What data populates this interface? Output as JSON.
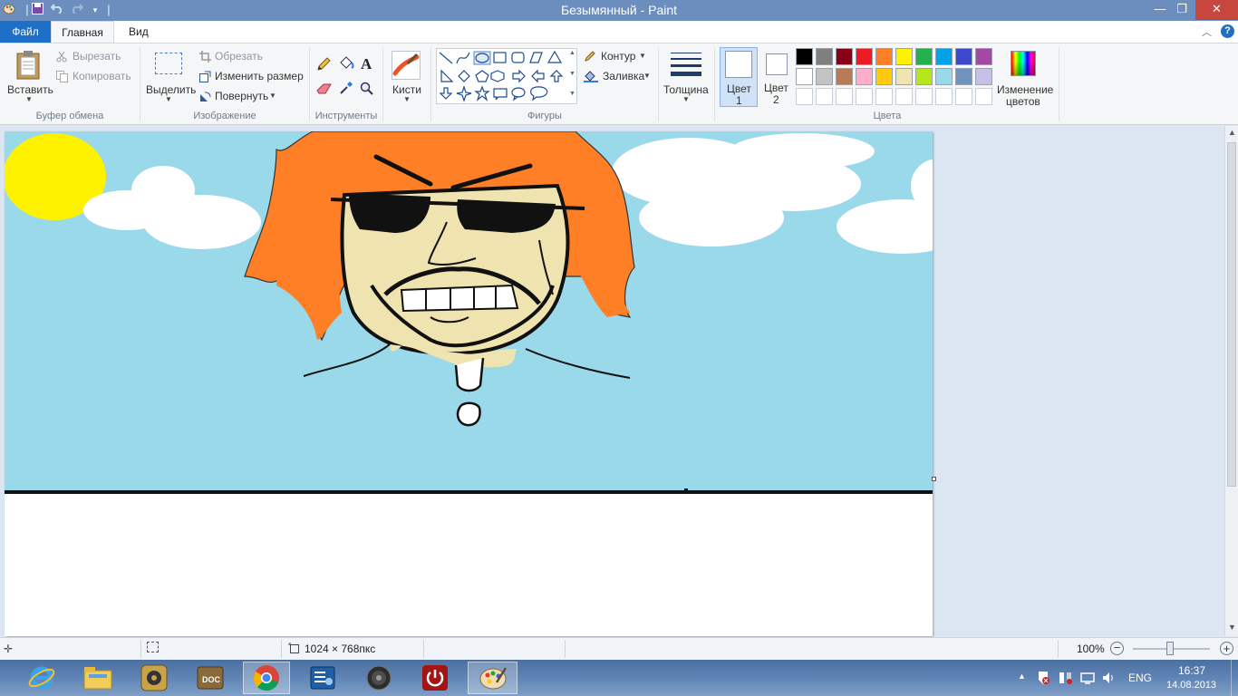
{
  "window": {
    "title": "Безымянный - Paint",
    "minimize_icon": "minimize-icon",
    "restore_icon": "restore-icon",
    "close_icon": "close-icon"
  },
  "quick_access": [
    "paint-app-icon",
    "save-icon",
    "undo-icon",
    "redo-icon",
    "customize-dropdown-icon"
  ],
  "tabs": {
    "file": "Файл",
    "home": "Главная",
    "view": "Вид"
  },
  "ribbon": {
    "clipboard": {
      "paste": "Вставить",
      "cut": "Вырезать",
      "copy": "Копировать",
      "group": "Буфер обмена"
    },
    "image": {
      "select": "Выделить",
      "crop": "Обрезать",
      "resize": "Изменить размер",
      "rotate": "Повернуть",
      "group": "Изображение"
    },
    "tools": {
      "group": "Инструменты"
    },
    "brushes": {
      "label": "Кисти"
    },
    "shapes": {
      "outline": "Контур",
      "fill": "Заливка",
      "group": "Фигуры"
    },
    "size": {
      "label": "Толщина"
    },
    "colors": {
      "color1_line1": "Цвет",
      "color1_line2": "1",
      "color2_line1": "Цвет",
      "color2_line2": "2",
      "edit_line1": "Изменение",
      "edit_line2": "цветов",
      "group": "Цвета",
      "palette_row1": [
        "#000000",
        "#7f7f7f",
        "#880015",
        "#ed1c24",
        "#ff7f27",
        "#fff200",
        "#22b14c",
        "#00a2e8",
        "#3f48cc",
        "#a349a4"
      ],
      "palette_row2": [
        "#ffffff",
        "#c3c3c3",
        "#b97a57",
        "#ffaec9",
        "#ffc90e",
        "#efe4b0",
        "#b5e61d",
        "#99d9ea",
        "#7092be",
        "#c8bfe7"
      ]
    }
  },
  "status": {
    "image_size": "1024 × 768пкс",
    "zoom": "100%"
  },
  "taskbar": {
    "apps": [
      "internet-explorer-icon",
      "file-explorer-icon",
      "media-player-icon",
      "doc-viewer-icon",
      "chrome-icon",
      "control-panel-icon",
      "speaker-app-icon",
      "power-app-icon",
      "paint-taskbar-icon"
    ],
    "lang": "ENG",
    "time": "16:37",
    "date": "14.08.2013"
  },
  "drawing": {
    "sky_color": "#99d9ea",
    "sun_color": "#fff200",
    "hair_color": "#ff7f27",
    "skin_color": "#efe4b0"
  }
}
